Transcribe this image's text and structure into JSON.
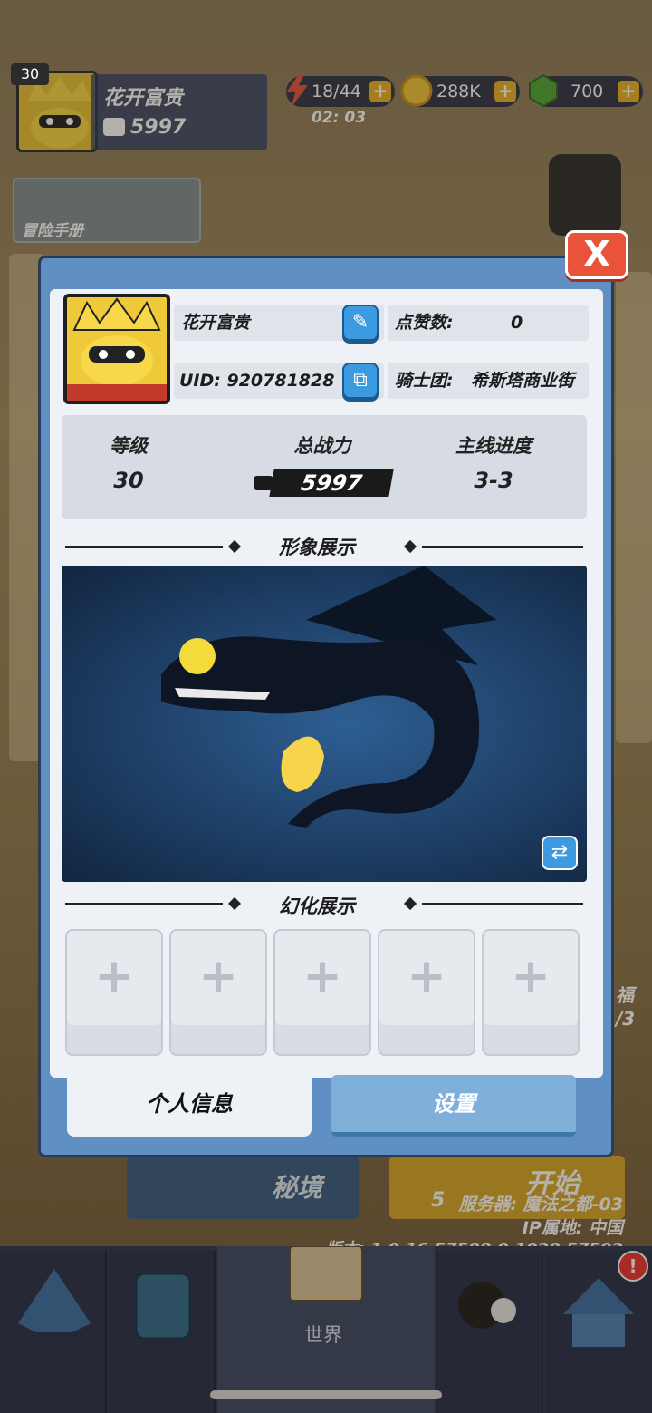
{
  "hud": {
    "level": "30",
    "player_name": "花开富贵",
    "power": "5997",
    "energy": "18/44",
    "energy_timer": "02: 03",
    "gold": "288K",
    "gems": "700",
    "plus": "+",
    "adventure_manual": "冒险手册"
  },
  "profile": {
    "name": "花开富贵",
    "likes_label": "点赞数:",
    "likes_value": "0",
    "uid": "UID: 920781828",
    "guild_label": "骑士团:",
    "guild_value": "希斯塔商业街",
    "close": "X"
  },
  "stats": {
    "level_label": "等级",
    "level_value": "30",
    "power_label": "总战力",
    "power_value": "5997",
    "progress_label": "主线进度",
    "progress_value": "3-3"
  },
  "sections": {
    "appearance": "形象展示",
    "transform": "幻化展示"
  },
  "slots": [
    "+",
    "+",
    "+",
    "+",
    "+"
  ],
  "tabs": {
    "personal": "个人信息",
    "settings": "设置"
  },
  "bottom": {
    "secret_realm": "秘境",
    "start": "开始",
    "start_cost": "5",
    "server": "服务器: 魔法之都-03",
    "ip": "IP属地: 中国",
    "version": "版本: 1.0.16.57588.0.1028.57592",
    "world": "世界",
    "alert": "!",
    "side_fu": "福",
    "side_fraction": "/3"
  },
  "colors": {
    "modal_blue": "#5f8fc3",
    "accent_blue": "#3c9be0",
    "close_red": "#e9533a",
    "gold": "#e8b22a"
  }
}
